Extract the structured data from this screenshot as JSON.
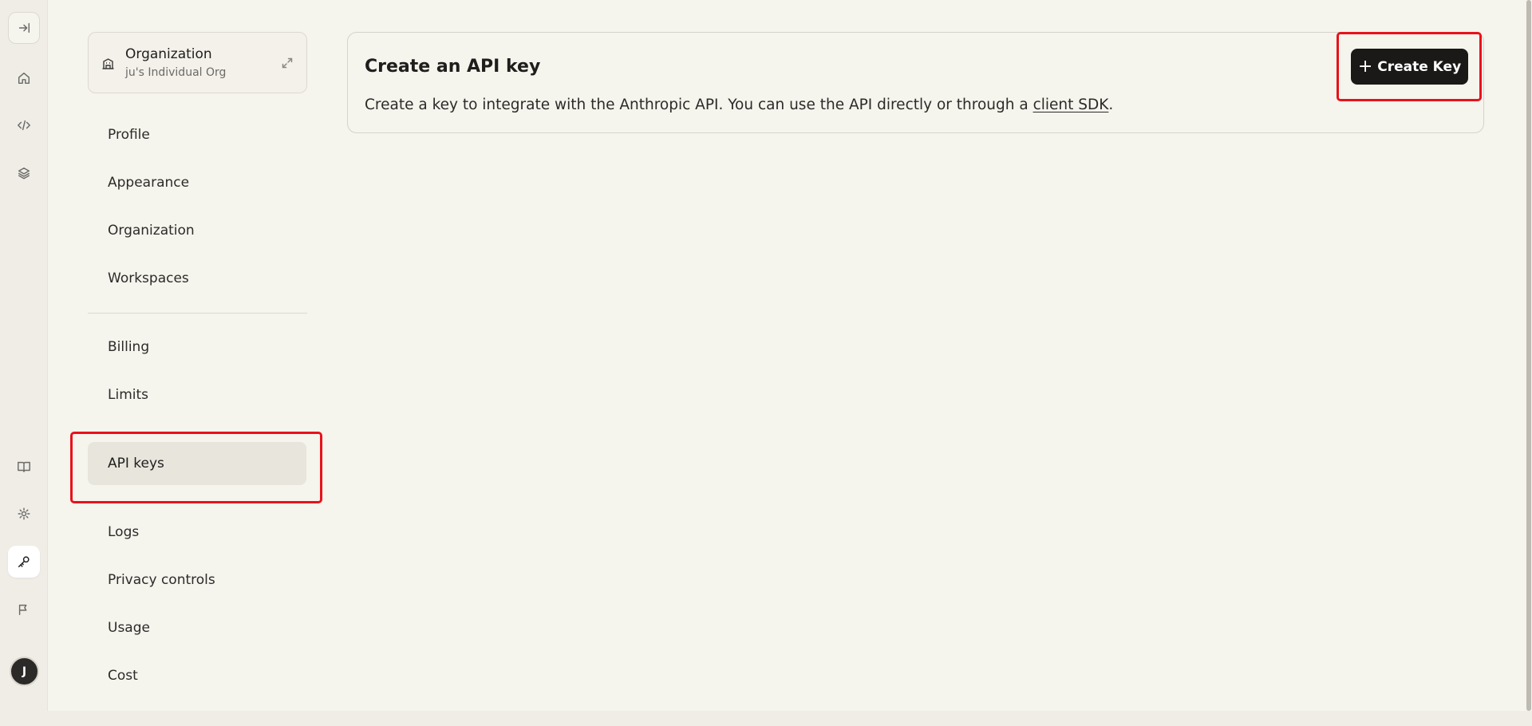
{
  "rail": {
    "items": [
      {
        "name": "collapse-sidebar-icon"
      },
      {
        "name": "home-icon"
      },
      {
        "name": "code-icon"
      },
      {
        "name": "layers-icon"
      },
      {
        "name": "book-icon"
      },
      {
        "name": "gear-icon"
      },
      {
        "name": "key-icon"
      },
      {
        "name": "flag-icon"
      }
    ],
    "avatar_initial": "J"
  },
  "org": {
    "title": "Organization",
    "subtitle": "ju's Individual Org"
  },
  "nav": {
    "items": [
      {
        "label": "Profile"
      },
      {
        "label": "Appearance"
      },
      {
        "label": "Organization"
      },
      {
        "label": "Workspaces"
      },
      {
        "label": "Billing"
      },
      {
        "label": "Limits"
      },
      {
        "label": "API keys",
        "active": true
      },
      {
        "label": "Logs"
      },
      {
        "label": "Privacy controls"
      },
      {
        "label": "Usage"
      },
      {
        "label": "Cost"
      }
    ]
  },
  "api_card": {
    "title": "Create an API key",
    "description_prefix": "Create a key to integrate with the Anthropic API. You can use the API directly or through a ",
    "link_text": "client SDK",
    "description_suffix": ".",
    "create_button_plus": "+",
    "create_button_label": "Create Key"
  },
  "colors": {
    "background": "#f5f4ed",
    "button_bg": "#1a1917",
    "highlight": "#e8121b",
    "active_nav": "#e8e5dd"
  }
}
